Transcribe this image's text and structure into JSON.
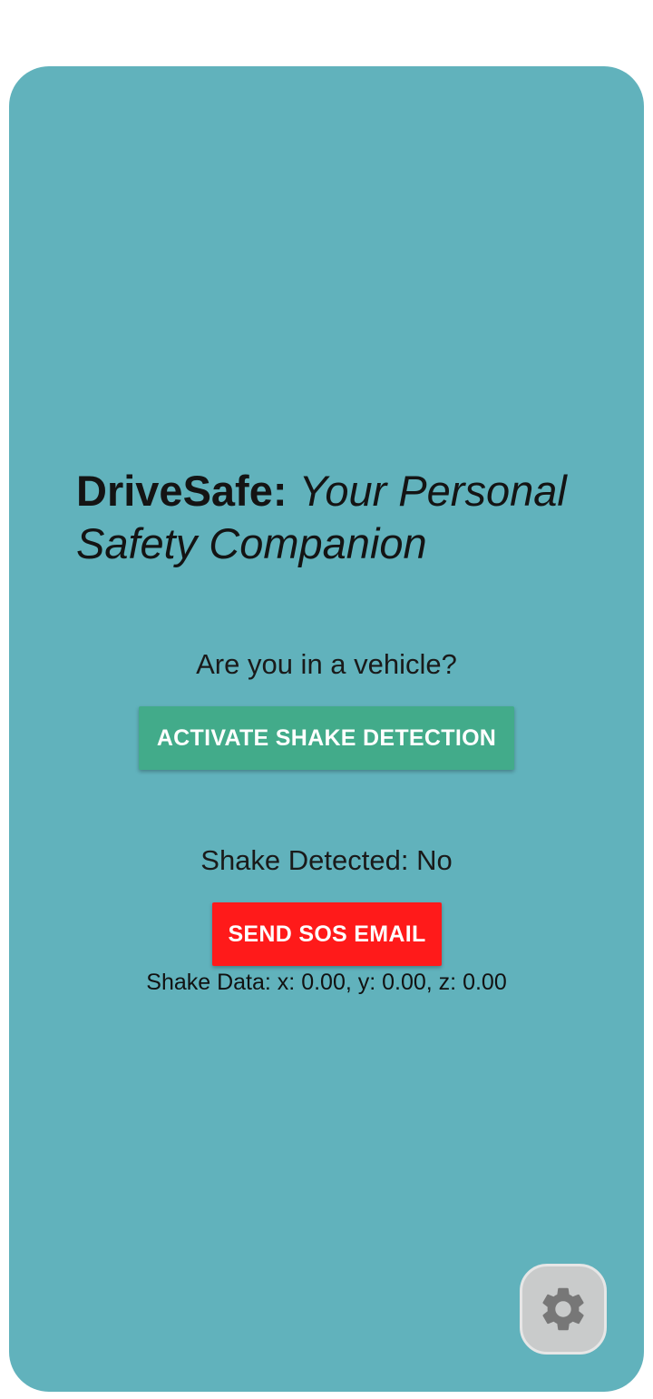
{
  "header": {
    "brand": "DriveSafe:",
    "tagline": "Your Personal Safety Companion"
  },
  "vehicle_prompt": "Are you in a vehicle?",
  "activate_button_label": "ACTIVATE SHAKE DETECTION",
  "shake_status": "Shake Detected: No",
  "sos_button_label": "SEND SOS EMAIL",
  "shake_data": "Shake Data: x: 0.00, y: 0.00, z: 0.00",
  "settings_button": {
    "icon": "gear-icon"
  },
  "colors": {
    "background": "#61b2bc",
    "activate_button": "#42ab8a",
    "sos_button": "#ff1a1a",
    "settings_fab": "#c9cbcb"
  }
}
